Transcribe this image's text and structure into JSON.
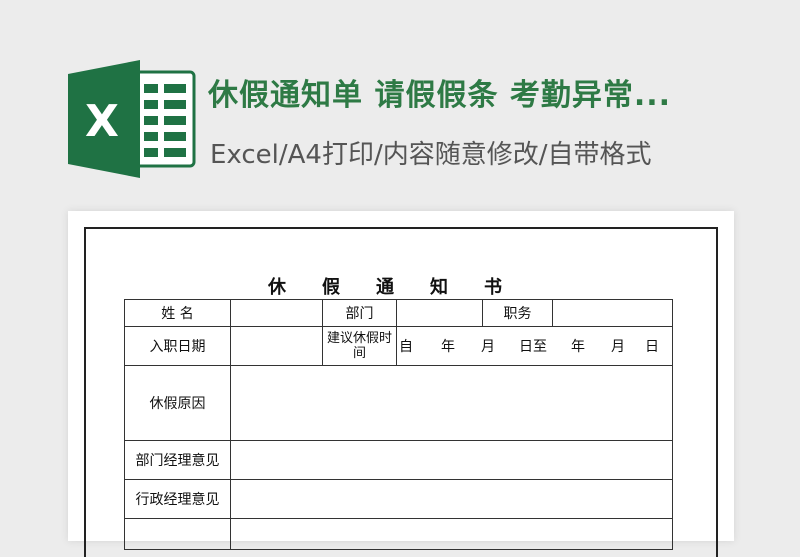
{
  "header": {
    "title": "休假通知单 请假假条 考勤异常...",
    "subtitle": "Excel/A4打印/内容随意修改/自带格式"
  },
  "colors": {
    "excel_green": "#1f7244",
    "title_green": "#2e7a45"
  },
  "icons": {
    "logo": "excel-logo-icon"
  },
  "doc": {
    "title": "休假通知书",
    "labels": {
      "name": "姓 名",
      "department": "部门",
      "position": "职务",
      "hire_date": "入职日期",
      "suggested_leave_time": "建议休假时间",
      "leave_reason": "休假原因",
      "dept_manager_opinion": "部门经理意见",
      "admin_manager_opinion": "行政经理意见"
    },
    "date_range": {
      "from": "自",
      "year": "年",
      "month": "月",
      "day_to": "日至",
      "year2": "年",
      "month2": "月",
      "day2": "日"
    },
    "values": {
      "name": "",
      "hire_date": "",
      "department": "",
      "position": "",
      "leave_reason": "",
      "dept_manager_opinion": "",
      "admin_manager_opinion": ""
    }
  }
}
